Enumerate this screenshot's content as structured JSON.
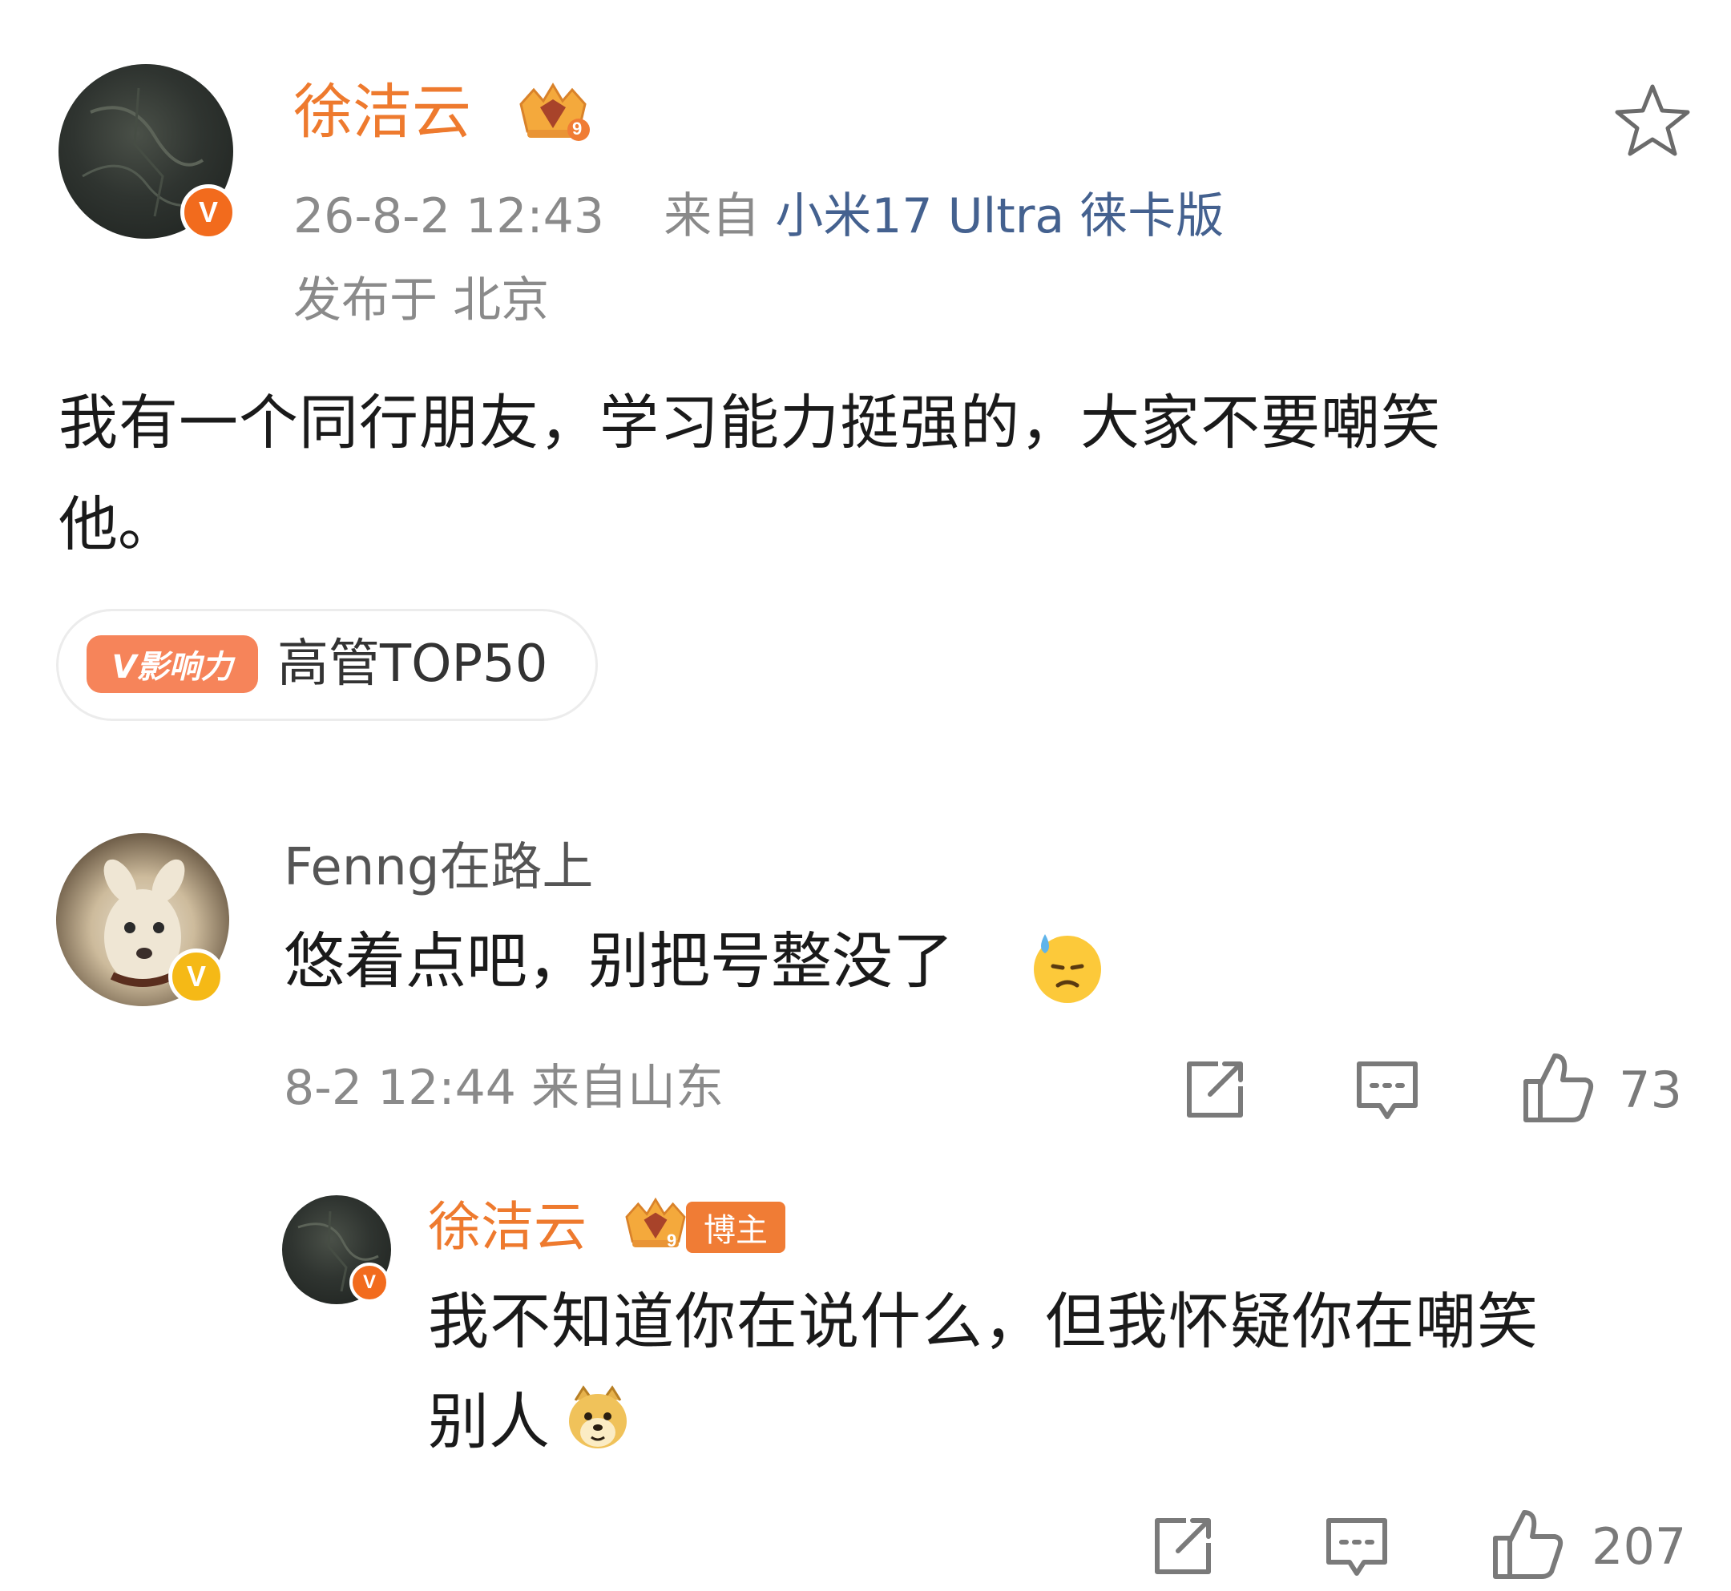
{
  "post": {
    "author_name": "徐洁云",
    "author_level": "9",
    "timestamp": "26-8-2 12:43",
    "source_prefix": "来自",
    "source_device": "小米17 Ultra 徕卡版",
    "location": "发布于 北京",
    "content_line1": "我有一个同行朋友，学习能力挺强的，大家不要嘲笑",
    "content_line2": "他。",
    "influence_badge": "V影响力",
    "influence_text": "高管TOP50"
  },
  "comment": {
    "author_name": "Fenng在路上",
    "content": "悠着点吧，别把号整没了",
    "meta": "8-2 12:44 来自山东",
    "like_count": "73"
  },
  "reply": {
    "author_name": "徐洁云",
    "author_level": "9",
    "badge": "博主",
    "content_line1": "我不知道你在说什么，但我怀疑你在嘲笑",
    "content_line2": "别人",
    "like_count": "207"
  },
  "colors": {
    "accent_orange": "#ee7a2e",
    "verified_orange": "#f26b1d",
    "verified_yellow": "#f5b916",
    "source_blue": "#44618f",
    "meta_gray": "#8a8a8a"
  },
  "icons": [
    "star-icon",
    "share-icon",
    "comment-icon",
    "like-icon",
    "crown-icon",
    "verified-icon",
    "sweat-emoji-icon",
    "doge-emoji-icon"
  ]
}
